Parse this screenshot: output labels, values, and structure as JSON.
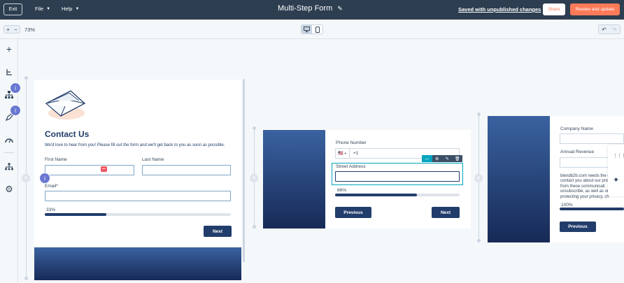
{
  "topbar": {
    "exit_label": "Exit",
    "menu_file": "File",
    "menu_help": "Help",
    "title": "Multi-Step Form",
    "saved_status": "Saved with unpublished changes",
    "share_label": "Share",
    "review_label": "Review and update"
  },
  "toolbar": {
    "zoom_in": "+",
    "zoom_out": "−",
    "zoom_level": "73%"
  },
  "sidebar": {
    "badge_1": "i",
    "badge_2": "i"
  },
  "step1": {
    "heading": "Contact Us",
    "intro": "We'd love to hear from you! Please fill out the form and we'll get back to you as soon as possible.",
    "first_name_label": "First Name",
    "last_name_label": "Last Name",
    "email_label": "Email*",
    "progress_label": "33%",
    "progress": 0.33,
    "next_label": "Next",
    "info_badge": "i",
    "autofill_icon": "•••"
  },
  "step2": {
    "phone_label": "Phone Number",
    "phone_flag": "🇺🇸",
    "phone_prefix": "+1",
    "street_label": "Street Address",
    "progress_label": "66%",
    "progress": 0.66,
    "previous_label": "Previous",
    "next_label": "Next"
  },
  "step3": {
    "company_label": "Company Name",
    "revenue_label": "Annual Revenue",
    "consent_line1": "blendb2b.com needs the c",
    "consent_line2": "contact you about our pro",
    "consent_line3": "from these communicati",
    "consent_line4": "unsubscribe, as well as ou",
    "consent_line5": "protecting your privacy, ch",
    "progress_label": "100%",
    "progress": 1.0,
    "previous_label": "Previous"
  },
  "colors": {
    "topbar": "#2d3e50",
    "accent_orange": "#ff7a59",
    "navy_button": "#213d6b",
    "badge_purple": "#6a78d1",
    "teal": "#00a4bd"
  }
}
